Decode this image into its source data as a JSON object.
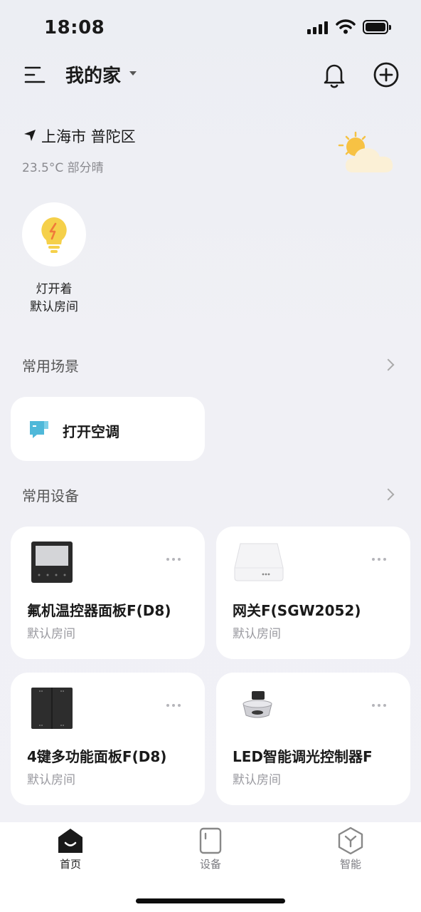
{
  "status_bar": {
    "time": "18:08"
  },
  "header": {
    "home_name": "我的家"
  },
  "weather": {
    "location": "上海市 普陀区",
    "temperature": "23.5°C",
    "condition": "部分晴"
  },
  "quick_device": {
    "label": "灯开着",
    "room": "默认房间"
  },
  "scenes": {
    "title": "常用场景",
    "items": [
      {
        "label": "打开空调"
      }
    ]
  },
  "devices": {
    "title": "常用设备",
    "items": [
      {
        "name": "氟机温控器面板F(D8)",
        "room": "默认房间"
      },
      {
        "name": "网关F(SGW2052)",
        "room": "默认房间"
      },
      {
        "name": "4键多功能面板F(D8)",
        "room": "默认房间"
      },
      {
        "name": "LED智能调光控制器F",
        "room": "默认房间"
      }
    ]
  },
  "tabs": [
    {
      "label": "首页",
      "active": true
    },
    {
      "label": "设备",
      "active": false
    },
    {
      "label": "智能",
      "active": false
    }
  ],
  "colors": {
    "accent": "#111111",
    "card": "#ffffff",
    "muted": "#9a9aa0",
    "bulb": "#f5d04a"
  }
}
